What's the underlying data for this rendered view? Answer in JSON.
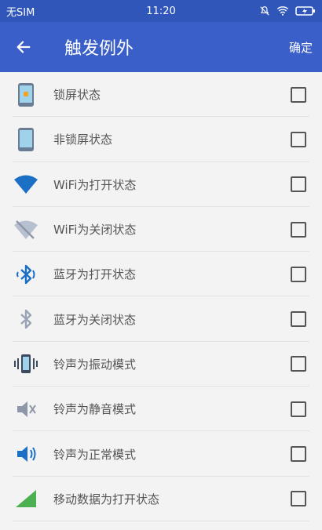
{
  "status_bar": {
    "carrier": "无SIM",
    "time": "11:20"
  },
  "app_bar": {
    "title": "触发例外",
    "confirm_label": "确定"
  },
  "items": [
    {
      "label": "锁屏状态",
      "icon": "locked-phone-icon"
    },
    {
      "label": "非锁屏状态",
      "icon": "unlocked-phone-icon"
    },
    {
      "label": "WiFi为打开状态",
      "icon": "wifi-on-icon"
    },
    {
      "label": "WiFi为关闭状态",
      "icon": "wifi-off-icon"
    },
    {
      "label": "蓝牙为打开状态",
      "icon": "bluetooth-on-icon"
    },
    {
      "label": "蓝牙为关闭状态",
      "icon": "bluetooth-off-icon"
    },
    {
      "label": "铃声为振动模式",
      "icon": "vibrate-icon"
    },
    {
      "label": "铃声为静音模式",
      "icon": "mute-icon"
    },
    {
      "label": "铃声为正常模式",
      "icon": "volume-icon"
    },
    {
      "label": "移动数据为打开状态",
      "icon": "mobile-data-icon"
    }
  ],
  "colors": {
    "primary": "#3a5fc9",
    "status": "#2f56b8",
    "icon_blue": "#1b6fc4",
    "icon_grey": "#9aa4b5",
    "icon_green": "#4caf50"
  }
}
